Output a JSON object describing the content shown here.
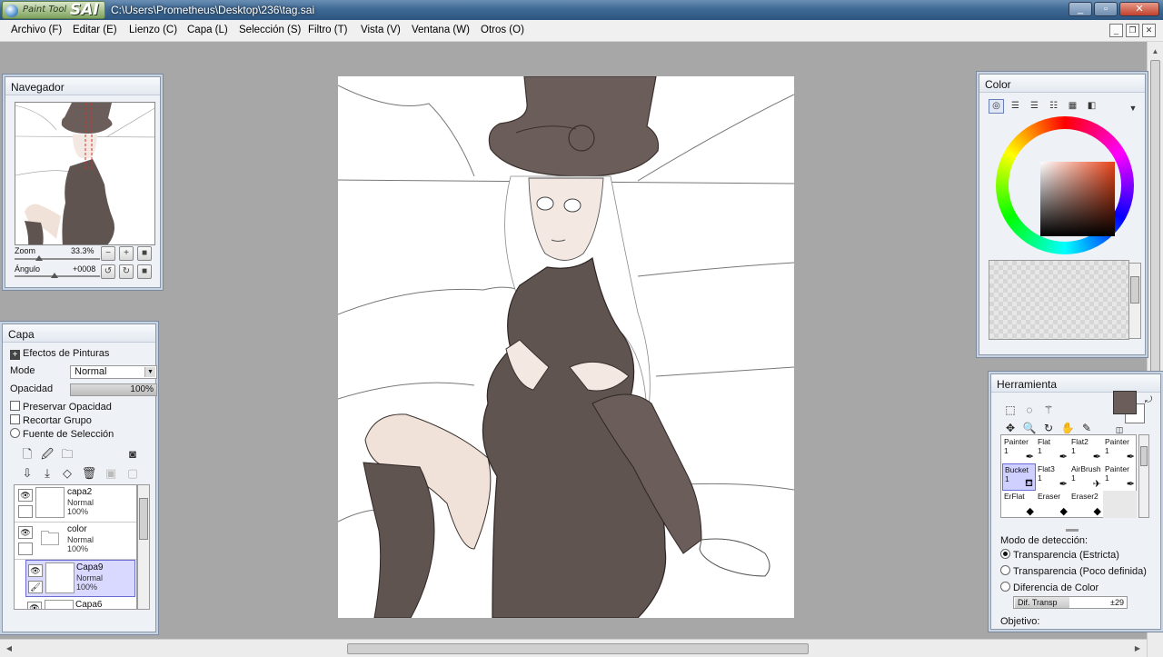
{
  "titlebar": {
    "app_name_small": "Paint Tool",
    "app_name_big": "SAI",
    "path": "C:\\Users\\Prometheus\\Desktop\\236\\tag.sai"
  },
  "window_buttons": {
    "minimize": "_",
    "maximize": "▫",
    "close": "✕"
  },
  "menu": [
    "Archivo (F)",
    "Editar (E)",
    "Lienzo (C)",
    "Capa (L)",
    "Selección (S)",
    "Filtro (T)",
    "Vista (V)",
    "Ventana (W)",
    "Otros (O)"
  ],
  "navigator": {
    "title": "Navegador",
    "zoom_label": "Zoom",
    "zoom_value": "33.3%",
    "angle_label": "Ángulo",
    "angle_value": "+0008",
    "zoom_buttons": [
      "−",
      "+",
      "■"
    ],
    "angle_buttons": [
      "↺",
      "↻",
      "■"
    ]
  },
  "layer_panel": {
    "title": "Capa",
    "effects_label": "Efectos de Pinturas",
    "mode_label": "Mode",
    "mode_value": "Normal",
    "opacity_label": "Opacidad",
    "opacity_value": "100%",
    "preserve_opacity": "Preservar Opacidad",
    "clip_group": "Recortar Grupo",
    "selection_source": "Fuente de Selección",
    "layers": [
      {
        "name": "capa2",
        "mode": "Normal",
        "opacity": "100%"
      },
      {
        "name": "color",
        "mode": "Normal",
        "opacity": "100%"
      },
      {
        "name": "Capa9",
        "mode": "Normal",
        "opacity": "100%"
      },
      {
        "name": "Capa6",
        "mode": "",
        "opacity": ""
      }
    ]
  },
  "color_panel": {
    "title": "Color",
    "fg_color": "#6b5e5a",
    "bg_color": "#ffffff"
  },
  "tool_panel": {
    "title": "Herramienta",
    "brushes": [
      {
        "name": "Painter",
        "size": "1"
      },
      {
        "name": "Flat",
        "size": "1"
      },
      {
        "name": "Flat2",
        "size": "1"
      },
      {
        "name": "Painter",
        "size": "1"
      },
      {
        "name": "Bucket",
        "size": "1"
      },
      {
        "name": "Flat3",
        "size": "1"
      },
      {
        "name": "AirBrush",
        "size": "1"
      },
      {
        "name": "Painter",
        "size": "1"
      },
      {
        "name": "ErFlat",
        "size": ""
      },
      {
        "name": "Eraser",
        "size": ""
      },
      {
        "name": "Eraser2",
        "size": ""
      },
      {
        "name": "",
        "size": ""
      }
    ],
    "detection_label": "Modo de detección:",
    "detection_options": [
      "Transparencia (Estricta)",
      "Transparencia (Poco definida)",
      "Diferencia de Color"
    ],
    "dif_label": "Dif. Transp",
    "dif_value": "±29",
    "objective_label": "Objetivo:"
  }
}
